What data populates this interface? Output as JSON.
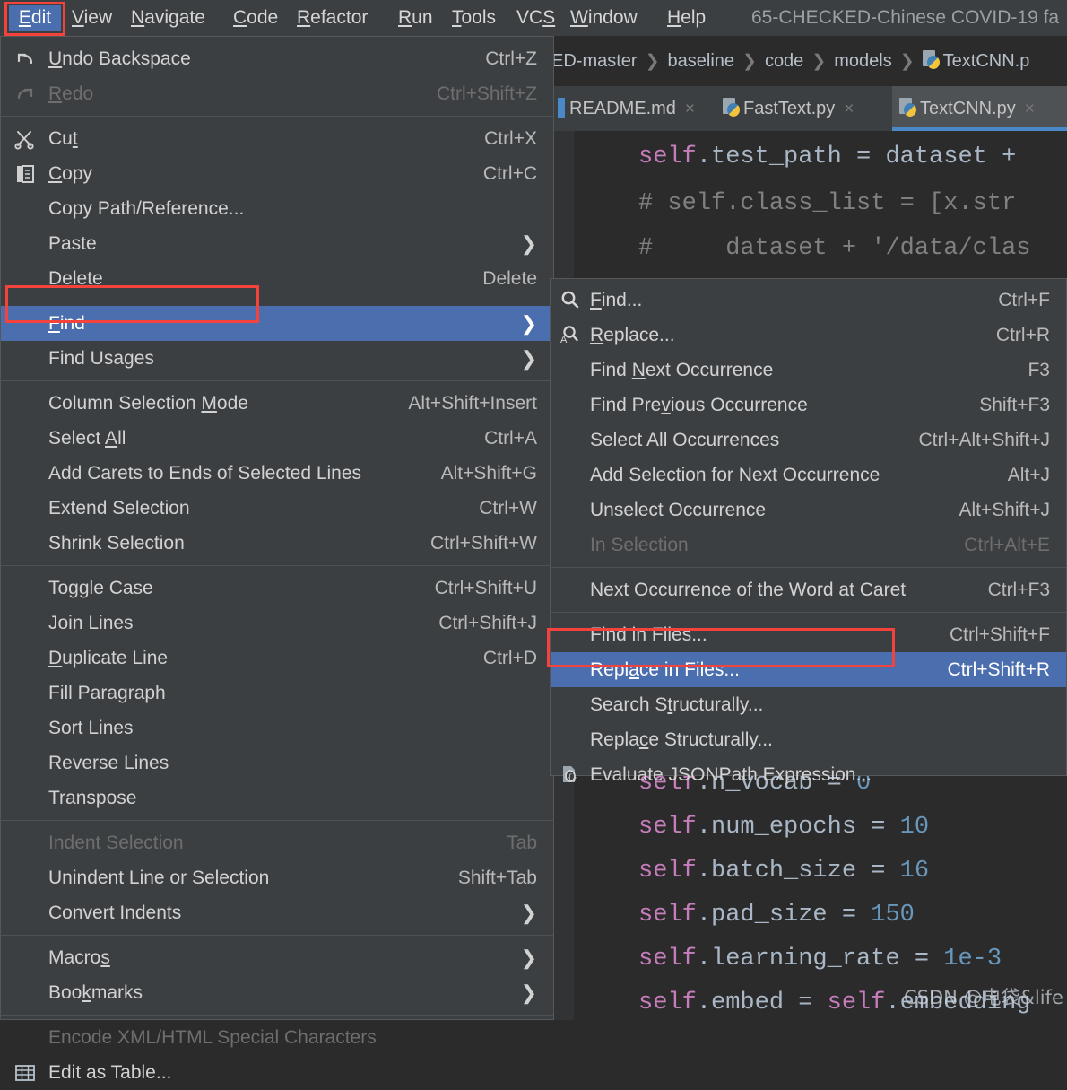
{
  "app": {
    "project_title": "65-CHECKED-Chinese COVID-19 fa",
    "accent_blue": "#4b6eaf",
    "annotation_red": "#f4433c",
    "menu_bg": "#3c3f41",
    "editor_bg": "#2b2b2b"
  },
  "menubar": {
    "items": [
      {
        "label": "Edit",
        "mnemonic": "E",
        "selected": true
      },
      {
        "label": "View",
        "mnemonic": "V",
        "selected": false
      },
      {
        "label": "Navigate",
        "mnemonic": "N",
        "selected": false
      },
      {
        "label": "Code",
        "mnemonic": "C",
        "selected": false
      },
      {
        "label": "Refactor",
        "mnemonic": "R",
        "selected": false
      },
      {
        "label": "Run",
        "mnemonic": "R",
        "selected": false
      },
      {
        "label": "Tools",
        "mnemonic": "T",
        "selected": false
      },
      {
        "label": "VCS",
        "mnemonic": "S",
        "selected": false
      },
      {
        "label": "Window",
        "mnemonic": "W",
        "selected": false
      },
      {
        "label": "Help",
        "mnemonic": "H",
        "selected": false
      }
    ]
  },
  "breadcrumb": {
    "items": [
      "ED-master",
      "baseline",
      "code",
      "models"
    ],
    "file": "TextCNN.p",
    "separator": "❯"
  },
  "tabs": [
    {
      "label": "README.md",
      "icon": "markdown-icon",
      "active": false,
      "close": "×"
    },
    {
      "label": "FastText.py",
      "icon": "python-file-icon",
      "active": false,
      "close": "×"
    },
    {
      "label": "TextCNN.py",
      "icon": "python-file-icon",
      "active": true,
      "close": "×"
    }
  ],
  "editor": {
    "top_lines": [
      "    self.test_path = dataset +",
      "    # self.class_list = [x.str",
      "    #      dataset + '/data/clas"
    ],
    "bottom_lines": [
      "    self.n_vocab = 0",
      "    self.num_epochs = 10",
      "    self.batch_size = 16",
      "    self.pad_size = 150",
      "    self.learning_rate = 1e-3",
      "    self.embed = self.embedding"
    ],
    "values": {
      "n_vocab": "0",
      "num_epochs": "10",
      "batch_size": "16",
      "pad_size": "150",
      "learning_rate": "1e-3"
    }
  },
  "edit_menu": {
    "groups": [
      {
        "items": [
          {
            "label": "Undo Backspace",
            "accel": "Ctrl+Z",
            "icon": "undo-icon",
            "mn": "U",
            "disabled": false,
            "submenu": false
          },
          {
            "label": "Redo",
            "accel": "Ctrl+Shift+Z",
            "icon": "redo-icon",
            "mn": "R",
            "disabled": true,
            "submenu": false
          }
        ]
      },
      {
        "items": [
          {
            "label": "Cut",
            "accel": "Ctrl+X",
            "icon": "scissors-icon",
            "mn": "t",
            "disabled": false,
            "submenu": false
          },
          {
            "label": "Copy",
            "accel": "Ctrl+C",
            "icon": "copy-icon",
            "mn": "C",
            "disabled": false,
            "submenu": false
          },
          {
            "label": "Copy Path/Reference...",
            "accel": "",
            "icon": "",
            "mn": "",
            "disabled": false,
            "submenu": false
          },
          {
            "label": "Paste",
            "accel": "",
            "icon": "",
            "mn": "",
            "disabled": false,
            "submenu": true
          },
          {
            "label": "Delete",
            "accel": "Delete",
            "icon": "",
            "mn": "D",
            "disabled": false,
            "submenu": false
          }
        ]
      },
      {
        "items": [
          {
            "label": "Find",
            "accel": "",
            "icon": "",
            "mn": "F",
            "disabled": false,
            "submenu": true,
            "selected": true,
            "boxed": true
          },
          {
            "label": "Find Usages",
            "accel": "",
            "icon": "",
            "mn": "",
            "disabled": false,
            "submenu": true
          }
        ]
      },
      {
        "items": [
          {
            "label": "Column Selection Mode",
            "accel": "Alt+Shift+Insert",
            "icon": "",
            "mn": "M",
            "disabled": false,
            "submenu": false
          },
          {
            "label": "Select All",
            "accel": "Ctrl+A",
            "icon": "",
            "mn": "A",
            "disabled": false,
            "submenu": false
          },
          {
            "label": "Add Carets to Ends of Selected Lines",
            "accel": "Alt+Shift+G",
            "icon": "",
            "mn": "",
            "disabled": false,
            "submenu": false
          },
          {
            "label": "Extend Selection",
            "accel": "Ctrl+W",
            "icon": "",
            "mn": "",
            "disabled": false,
            "submenu": false
          },
          {
            "label": "Shrink Selection",
            "accel": "Ctrl+Shift+W",
            "icon": "",
            "mn": "",
            "disabled": false,
            "submenu": false
          }
        ]
      },
      {
        "items": [
          {
            "label": "Toggle Case",
            "accel": "Ctrl+Shift+U",
            "icon": "",
            "mn": "",
            "disabled": false,
            "submenu": false
          },
          {
            "label": "Join Lines",
            "accel": "Ctrl+Shift+J",
            "icon": "",
            "mn": "",
            "disabled": false,
            "submenu": false
          },
          {
            "label": "Duplicate Line",
            "accel": "Ctrl+D",
            "icon": "",
            "mn": "D",
            "disabled": false,
            "submenu": false
          },
          {
            "label": "Fill Paragraph",
            "accel": "",
            "icon": "",
            "mn": "",
            "disabled": false,
            "submenu": false
          },
          {
            "label": "Sort Lines",
            "accel": "",
            "icon": "",
            "mn": "",
            "disabled": false,
            "submenu": false
          },
          {
            "label": "Reverse Lines",
            "accel": "",
            "icon": "",
            "mn": "",
            "disabled": false,
            "submenu": false
          },
          {
            "label": "Transpose",
            "accel": "",
            "icon": "",
            "mn": "",
            "disabled": false,
            "submenu": false
          }
        ]
      },
      {
        "items": [
          {
            "label": "Indent Selection",
            "accel": "Tab",
            "icon": "",
            "mn": "",
            "disabled": true,
            "submenu": false
          },
          {
            "label": "Unindent Line or Selection",
            "accel": "Shift+Tab",
            "icon": "",
            "mn": "",
            "disabled": false,
            "submenu": false
          },
          {
            "label": "Convert Indents",
            "accel": "",
            "icon": "",
            "mn": "",
            "disabled": false,
            "submenu": true
          }
        ]
      },
      {
        "items": [
          {
            "label": "Macros",
            "accel": "",
            "icon": "",
            "mn": "s",
            "disabled": false,
            "submenu": true
          },
          {
            "label": "Bookmarks",
            "accel": "",
            "icon": "",
            "mn": "k",
            "disabled": false,
            "submenu": true
          }
        ]
      },
      {
        "items": [
          {
            "label": "Encode XML/HTML Special Characters",
            "accel": "",
            "icon": "",
            "mn": "",
            "disabled": true,
            "submenu": false
          },
          {
            "label": "Edit as Table...",
            "accel": "",
            "icon": "table-icon",
            "mn": "",
            "disabled": false,
            "submenu": false
          }
        ]
      }
    ]
  },
  "find_submenu": {
    "groups": [
      {
        "items": [
          {
            "label": "Find...",
            "accel": "Ctrl+F",
            "icon": "search-icon",
            "mn": "F",
            "disabled": false
          },
          {
            "label": "Replace...",
            "accel": "Ctrl+R",
            "icon": "replace-icon",
            "mn": "R",
            "disabled": false
          },
          {
            "label": "Find Next Occurrence",
            "accel": "F3",
            "icon": "",
            "mn": "N",
            "disabled": false
          },
          {
            "label": "Find Previous Occurrence",
            "accel": "Shift+F3",
            "icon": "",
            "mn": "v",
            "disabled": false
          },
          {
            "label": "Select All Occurrences",
            "accel": "Ctrl+Alt+Shift+J",
            "icon": "",
            "mn": "",
            "disabled": false
          },
          {
            "label": "Add Selection for Next Occurrence",
            "accel": "Alt+J",
            "icon": "",
            "mn": "",
            "disabled": false
          },
          {
            "label": "Unselect Occurrence",
            "accel": "Alt+Shift+J",
            "icon": "",
            "mn": "",
            "disabled": false
          },
          {
            "label": "In Selection",
            "accel": "Ctrl+Alt+E",
            "icon": "",
            "mn": "",
            "disabled": true
          }
        ]
      },
      {
        "items": [
          {
            "label": "Next Occurrence of the Word at Caret",
            "accel": "Ctrl+F3",
            "icon": "",
            "mn": "",
            "disabled": false
          }
        ]
      },
      {
        "items": [
          {
            "label": "Find in Files...",
            "accel": "Ctrl+Shift+F",
            "icon": "",
            "mn": "",
            "disabled": false
          },
          {
            "label": "Replace in Files...",
            "accel": "Ctrl+Shift+R",
            "icon": "",
            "mn": "a",
            "disabled": false,
            "selected": true,
            "boxed": true
          },
          {
            "label": "Search Structurally...",
            "accel": "",
            "icon": "",
            "mn": "t",
            "disabled": false
          },
          {
            "label": "Replace Structurally...",
            "accel": "",
            "icon": "",
            "mn": "c",
            "disabled": false
          },
          {
            "label": "Evaluate JSONPath Expression...",
            "accel": "",
            "icon": "jsonpath-icon",
            "mn": "",
            "disabled": false
          }
        ]
      }
    ]
  },
  "watermark": {
    "text": "CSDN @电袋&life"
  }
}
